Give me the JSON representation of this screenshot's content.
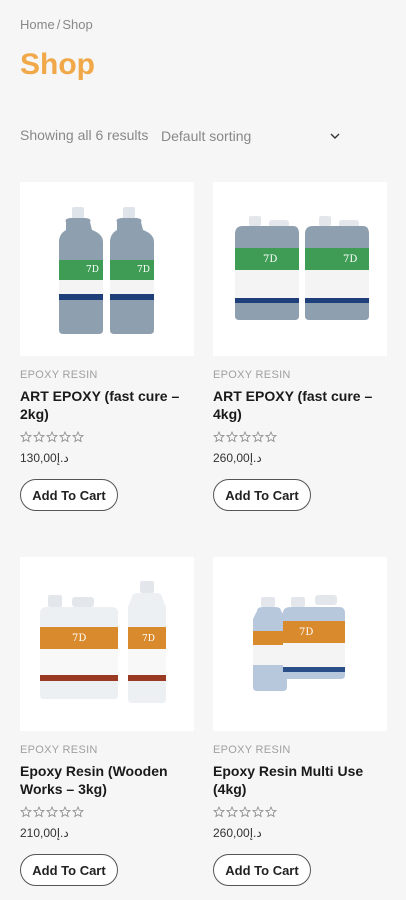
{
  "breadcrumb": {
    "home": "Home",
    "separator": "/",
    "current": "Shop"
  },
  "page_title": "Shop",
  "results_text": "Showing all 6 results",
  "sorting": {
    "selected": "Default sorting"
  },
  "colors": {
    "accent": "#f0a848",
    "green_label": "#3f9c55",
    "orange_label": "#d88a2c"
  },
  "products": [
    {
      "category": "EPOXY RESIN",
      "name": "ART EPOXY (fast cure – 2kg)",
      "currency": "د.إ",
      "price": "130,00",
      "button": "Add To Cart",
      "rating": 0,
      "brand": "7D"
    },
    {
      "category": "EPOXY RESIN",
      "name": "ART EPOXY (fast cure – 4kg)",
      "currency": "د.إ",
      "price": "260,00",
      "button": "Add To Cart",
      "rating": 0,
      "brand": "7D"
    },
    {
      "category": "EPOXY RESIN",
      "name": "Epoxy Resin (Wooden Works – 3kg)",
      "currency": "د.إ",
      "price": "210,00",
      "button": "Add To Cart",
      "rating": 0,
      "brand": "7D"
    },
    {
      "category": "EPOXY RESIN",
      "name": "Epoxy Resin Multi Use (4kg)",
      "currency": "د.إ",
      "price": "260,00",
      "button": "Add To Cart",
      "rating": 0,
      "brand": "7D"
    }
  ]
}
